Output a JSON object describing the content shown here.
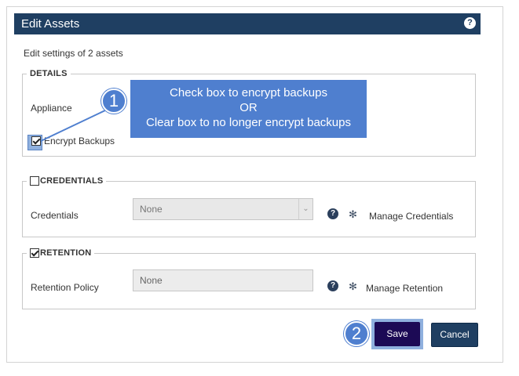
{
  "dialog": {
    "title": "Edit Assets",
    "help_icon": "question-icon",
    "subtitle": "Edit settings of 2 assets"
  },
  "details": {
    "legend": "DETAILS",
    "appliance_label": "Appliance",
    "encrypt_label": "Encrypt Backups",
    "encrypt_checked": true
  },
  "credentials": {
    "legend": "CREDENTIALS",
    "checked": false,
    "field_label": "Credentials",
    "select_value": "None",
    "manage_label": "Manage Credentials"
  },
  "retention": {
    "legend": "RETENTION",
    "checked": true,
    "field_label": "Retention Policy",
    "input_value": "None",
    "manage_label": "Manage Retention"
  },
  "callout": {
    "line1": "Check box to encrypt backups",
    "line2": "OR",
    "line3": "Clear box to no longer encrypt backups"
  },
  "badges": {
    "one": "1",
    "two": "2"
  },
  "buttons": {
    "save": "Save",
    "cancel": "Cancel"
  },
  "colors": {
    "titlebar": "#1f3f62",
    "callout": "#4f7fcf",
    "save": "#1c0a55",
    "cancel": "#1f3f62"
  }
}
